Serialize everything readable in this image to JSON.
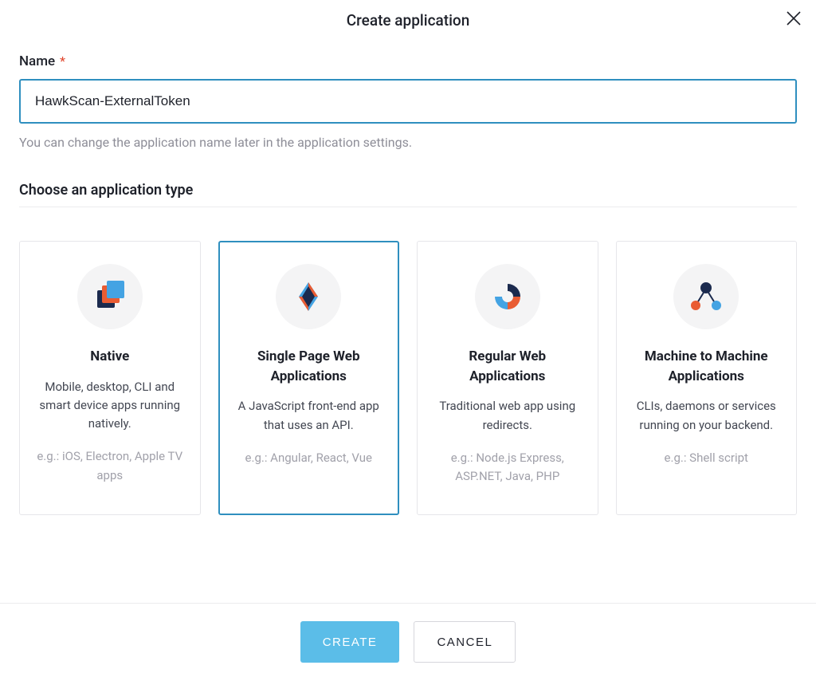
{
  "modal": {
    "title": "Create application",
    "close_icon": "close"
  },
  "name_field": {
    "label": "Name",
    "required_marker": "*",
    "value": "HawkScan-ExternalToken",
    "helper": "You can change the application name later in the application settings."
  },
  "type_section": {
    "heading": "Choose an application type"
  },
  "cards": {
    "native": {
      "title": "Native",
      "desc": "Mobile, desktop, CLI and smart device apps running natively.",
      "examples": "e.g.: iOS, Electron, Apple TV apps"
    },
    "spa": {
      "title": "Single Page Web Applications",
      "desc": "A JavaScript front-end app that uses an API.",
      "examples": "e.g.: Angular, React, Vue",
      "selected": true
    },
    "regular": {
      "title": "Regular Web Applications",
      "desc": "Traditional web app using redirects.",
      "examples": "e.g.: Node.js Express, ASP.NET, Java, PHP"
    },
    "m2m": {
      "title": "Machine to Machine Applications",
      "desc": "CLIs, daemons or services running on your backend.",
      "examples": "e.g.: Shell script"
    }
  },
  "footer": {
    "create_label": "CREATE",
    "cancel_label": "CANCEL"
  },
  "colors": {
    "accent": "#2f8fbf",
    "navy": "#1b2a4e",
    "orange": "#e95c33",
    "blue": "#44a3e3"
  }
}
